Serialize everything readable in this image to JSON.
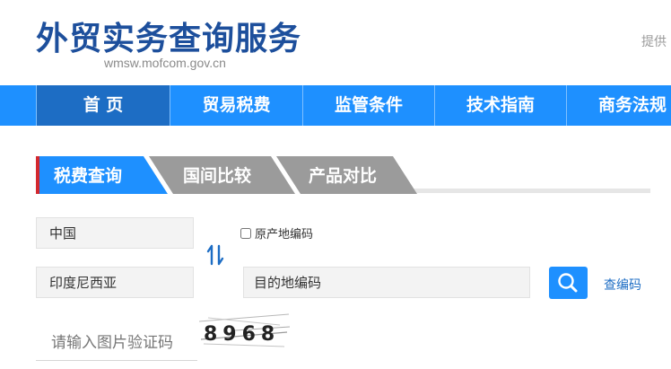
{
  "header": {
    "title": "外贸实务查询服务",
    "url": "wmsw.mofcom.gov.cn",
    "provider_text": "提供"
  },
  "nav": {
    "items": [
      {
        "label": "首 页",
        "active": true
      },
      {
        "label": "贸易税费",
        "active": false
      },
      {
        "label": "监管条件",
        "active": false
      },
      {
        "label": "技术指南",
        "active": false
      },
      {
        "label": "商务法规",
        "active": false
      }
    ]
  },
  "tabs": [
    {
      "label": "税费查询",
      "active": true
    },
    {
      "label": "国间比较",
      "active": false
    },
    {
      "label": "产品对比",
      "active": false
    }
  ],
  "form": {
    "origin_country": "中国",
    "origin_code_label": "原产地编码",
    "destination_country": "印度尼西亚",
    "destination_code_placeholder": "目的地编码",
    "lookup_code_link": "查编码",
    "captcha_placeholder": "请输入图片验证码",
    "captcha_text": "8968"
  },
  "colors": {
    "brand_blue": "#1d4f9c",
    "nav_blue": "#1e90ff",
    "nav_active": "#1d6dc4",
    "tab_gray": "#9b9b9b",
    "accent_red": "#d3282e"
  }
}
